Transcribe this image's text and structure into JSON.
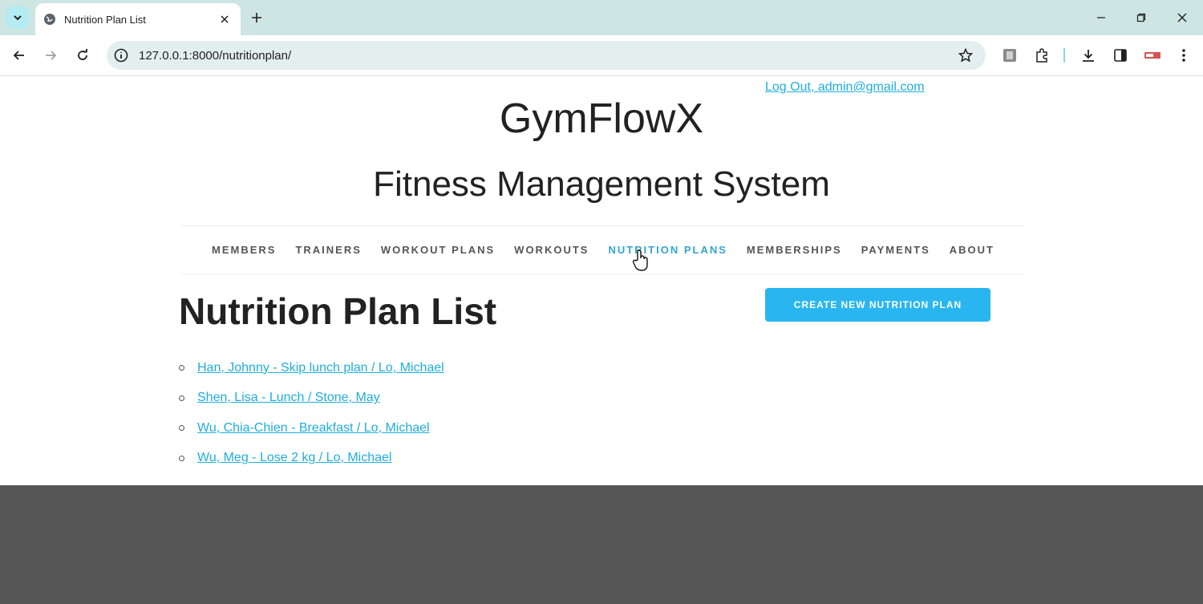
{
  "browser": {
    "tab_title": "Nutrition Plan List",
    "url": "127.0.0.1:8000/nutritionplan/"
  },
  "header": {
    "logout_link": "Log Out, admin@gmail.com",
    "brand": "GymFlowX",
    "subtitle": "Fitness Management System"
  },
  "nav": {
    "items": [
      "MEMBERS",
      "TRAINERS",
      "WORKOUT PLANS",
      "WORKOUTS",
      "NUTRITION PLANS",
      "MEMBERSHIPS",
      "PAYMENTS",
      "ABOUT"
    ],
    "active": "NUTRITION PLANS"
  },
  "main": {
    "title": "Nutrition Plan List",
    "create_button": "CREATE NEW NUTRITION PLAN",
    "plans": [
      "Han, Johnny - Skip lunch plan / Lo, Michael",
      "Shen, Lisa - Lunch / Stone, May",
      "Wu, Chia-Chien - Breakfast / Lo, Michael",
      "Wu, Meg - Lose 2 kg / Lo, Michael"
    ]
  },
  "colors": {
    "link": "#1eaedb",
    "button": "#29b6f0",
    "nav_active": "#33a6cf",
    "footer": "#555555",
    "tabstrip": "#cde5e3"
  }
}
